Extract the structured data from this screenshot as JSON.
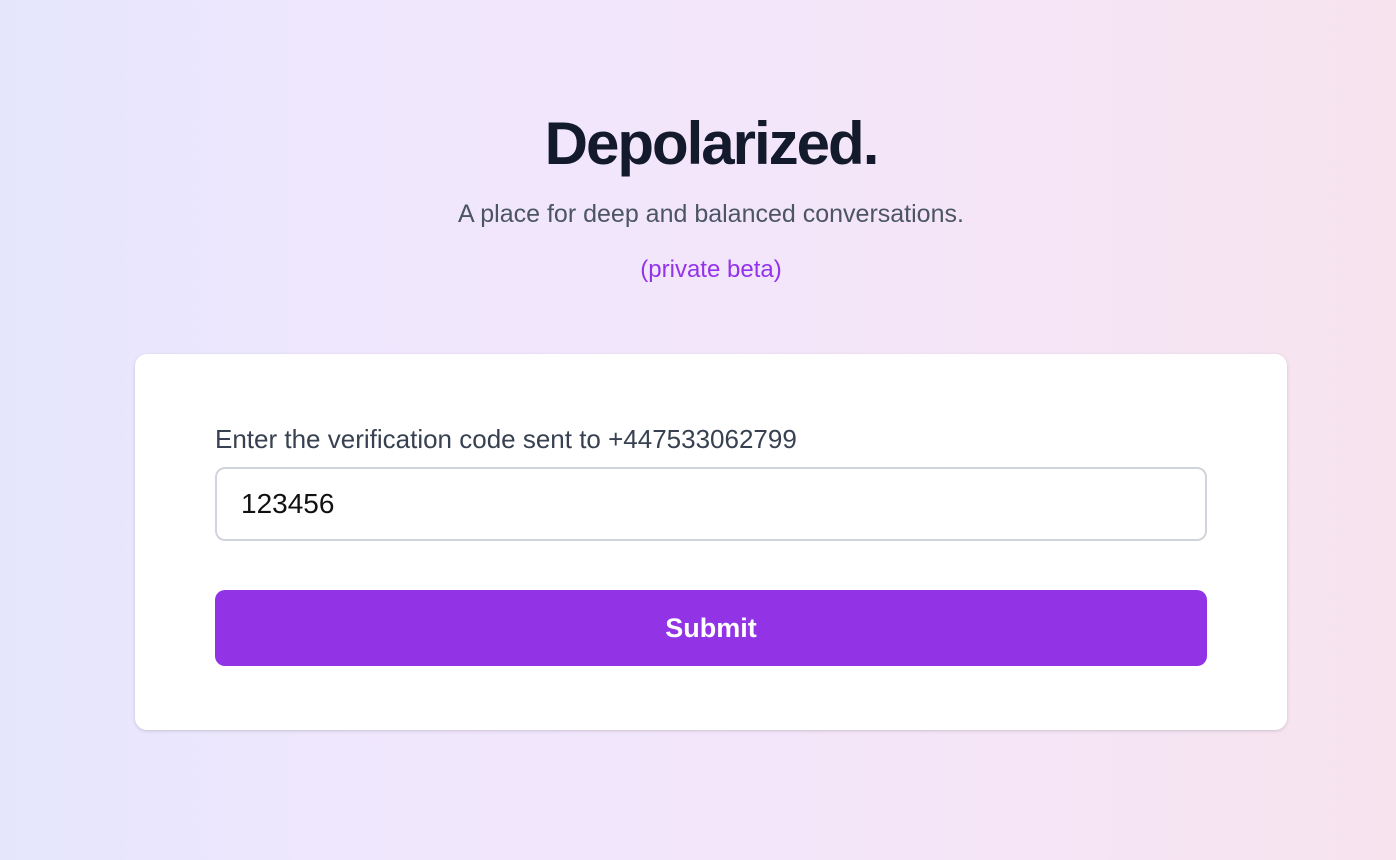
{
  "header": {
    "title": "Depolarized.",
    "tagline": "A place for deep and balanced conversations.",
    "beta_note": "(private beta)"
  },
  "form": {
    "label": "Enter the verification code sent to +447533062799",
    "code_value": "123456",
    "submit_label": "Submit"
  },
  "colors": {
    "accent": "#9333ea",
    "title": "#131a2b",
    "text_muted": "#4b5563",
    "label": "#374151"
  }
}
